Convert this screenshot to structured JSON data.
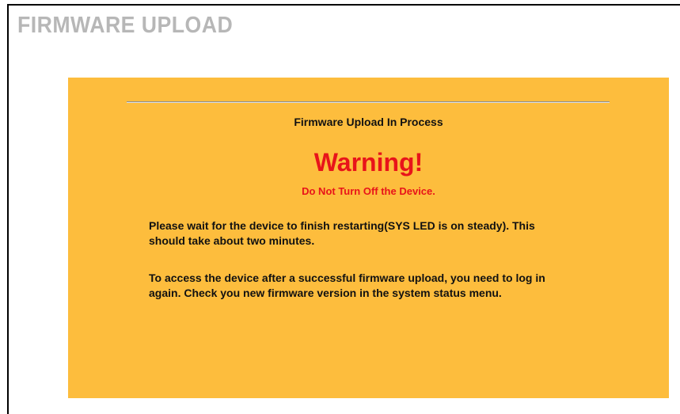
{
  "page": {
    "title": "FIRMWARE UPLOAD"
  },
  "status": {
    "heading": "Firmware Upload In Process",
    "warning_title": "Warning!",
    "warning_message": "Do Not Turn Off the Device.",
    "paragraphs": [
      "Please wait for the device to finish restarting(SYS LED is on steady). This should take about two minutes.",
      "To access the device after a successful firmware upload, you need to log in again. Check you new firmware version in the system status menu."
    ]
  },
  "colors": {
    "panel_background": "#fdbd3d",
    "warning": "#e8141a",
    "title_gray": "#b7b7b7"
  }
}
